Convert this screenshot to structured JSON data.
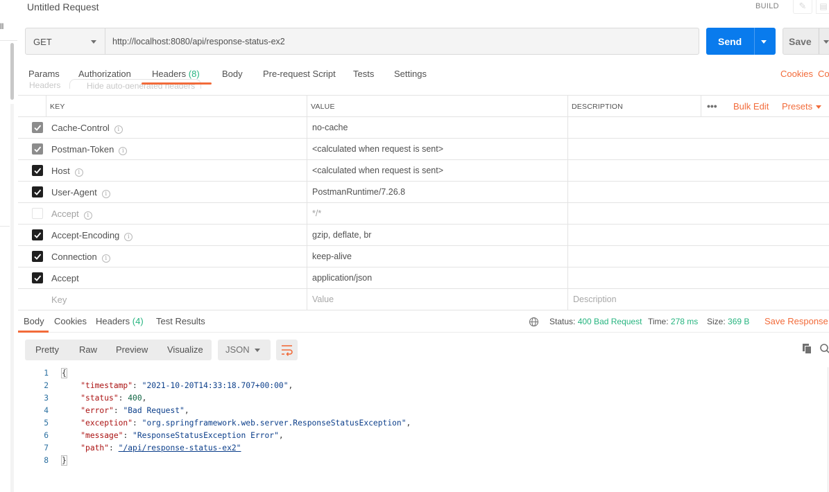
{
  "sidebar": {
    "clipped_label": "ll"
  },
  "header": {
    "title": "Untitled Request",
    "build_label": "BUILD"
  },
  "request": {
    "method": "GET",
    "url": "http://localhost:8080/api/response-status-ex2",
    "send_label": "Send",
    "save_label": "Save"
  },
  "request_tabs": [
    {
      "label": "Params",
      "count": ""
    },
    {
      "label": "Authorization",
      "count": ""
    },
    {
      "label": "Headers",
      "count": "(8)"
    },
    {
      "label": "Body",
      "count": ""
    },
    {
      "label": "Pre-request Script",
      "count": ""
    },
    {
      "label": "Tests",
      "count": ""
    },
    {
      "label": "Settings",
      "count": ""
    }
  ],
  "request_links": {
    "cookies": "Cookies",
    "code": "Co"
  },
  "ghost_toolbar": {
    "headers_label": "Headers",
    "hide_label": "Hide auto-generated headers"
  },
  "headers_table": {
    "columns": {
      "key": "KEY",
      "value": "VALUE",
      "description": "DESCRIPTION"
    },
    "bulk_edit": "Bulk Edit",
    "presets": "Presets",
    "rows": [
      {
        "key": "Cache-Control",
        "value": "no-cache",
        "state": "dim",
        "info": true
      },
      {
        "key": "Postman-Token",
        "value": "<calculated when request is sent>",
        "state": "dim",
        "info": true
      },
      {
        "key": "Host",
        "value": "<calculated when request is sent>",
        "state": "on",
        "info": true
      },
      {
        "key": "User-Agent",
        "value": "PostmanRuntime/7.26.8",
        "state": "on",
        "info": true
      },
      {
        "key": "Accept",
        "value": "*/*",
        "state": "off",
        "info": true
      },
      {
        "key": "Accept-Encoding",
        "value": "gzip, deflate, br",
        "state": "on",
        "info": true
      },
      {
        "key": "Connection",
        "value": "keep-alive",
        "state": "on",
        "info": true
      },
      {
        "key": "Accept",
        "value": "application/json",
        "state": "on",
        "info": false
      }
    ],
    "placeholder": {
      "key": "Key",
      "value": "Value",
      "description": "Description"
    }
  },
  "response": {
    "tabs": [
      {
        "label": "Body",
        "count": ""
      },
      {
        "label": "Cookies",
        "count": ""
      },
      {
        "label": "Headers",
        "count": "(4)"
      },
      {
        "label": "Test Results",
        "count": ""
      }
    ],
    "status_label": "Status:",
    "status_value": "400 Bad Request",
    "time_label": "Time:",
    "time_value": "278 ms",
    "size_label": "Size:",
    "size_value": "369 B",
    "save_response": "Save Response",
    "formats": [
      "Pretty",
      "Raw",
      "Preview",
      "Visualize"
    ],
    "language": "JSON",
    "body_lines": [
      {
        "n": "1"
      },
      {
        "n": "2",
        "key": "\"timestamp\"",
        "val": "\"2021-10-20T14:33:18.707+00:00\"",
        "type": "s"
      },
      {
        "n": "3",
        "key": "\"status\"",
        "val": "400",
        "type": "n"
      },
      {
        "n": "4",
        "key": "\"error\"",
        "val": "\"Bad Request\"",
        "type": "s"
      },
      {
        "n": "5",
        "key": "\"exception\"",
        "val": "\"org.springframework.web.server.ResponseStatusException\"",
        "type": "s"
      },
      {
        "n": "6",
        "key": "\"message\"",
        "val": "\"ResponseStatusException Error\"",
        "type": "s"
      },
      {
        "n": "7",
        "key": "\"path\"",
        "val": "\"/api/response-status-ex2\"",
        "type": "u"
      },
      {
        "n": "8"
      }
    ]
  },
  "colors": {
    "accent": "#f26b3a",
    "primary": "#097bed",
    "success": "#26b47f"
  },
  "icons": [
    "info-icon",
    "globe-icon",
    "wrap-lines-icon",
    "copy-icon",
    "search-icon",
    "pencil-icon",
    "document-icon",
    "more-icon"
  ]
}
